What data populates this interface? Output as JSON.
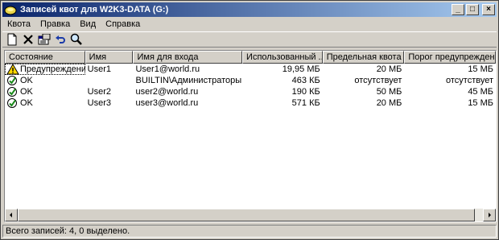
{
  "window": {
    "title": "Записей квот для W2K3-DATA (G:)"
  },
  "title_buttons": {
    "minimize": "_",
    "maximize": "□",
    "close": "×"
  },
  "menu": [
    "Квота",
    "Правка",
    "Вид",
    "Справка"
  ],
  "toolbar": [
    "new-entry-icon",
    "delete-icon",
    "properties-icon",
    "undo-icon",
    "find-icon"
  ],
  "columns": [
    "Состояние",
    "Имя",
    "Имя для входа",
    "Использованный ...",
    "Предельная квота",
    "Порог предупреждений"
  ],
  "rows": [
    {
      "status": "Предупреждение",
      "icon": "warning-icon",
      "name": "User1",
      "login": "User1@world.ru",
      "used": "19,95 МБ",
      "limit": "20 МБ",
      "threshold": "15 МБ"
    },
    {
      "status": "OK",
      "icon": "ok-icon",
      "name": "",
      "login": "BUILTIN\\Администраторы",
      "used": "463 КБ",
      "limit": "отсутствует",
      "threshold": "отсутствует"
    },
    {
      "status": "OK",
      "icon": "ok-icon",
      "name": "User2",
      "login": "user2@world.ru",
      "used": "190 КБ",
      "limit": "50 МБ",
      "threshold": "45 МБ"
    },
    {
      "status": "OK",
      "icon": "ok-icon",
      "name": "User3",
      "login": "user3@world.ru",
      "used": "571 КБ",
      "limit": "20 МБ",
      "threshold": "15 МБ"
    }
  ],
  "statusbar": {
    "text": "Всего записей: 4, 0 выделено."
  }
}
